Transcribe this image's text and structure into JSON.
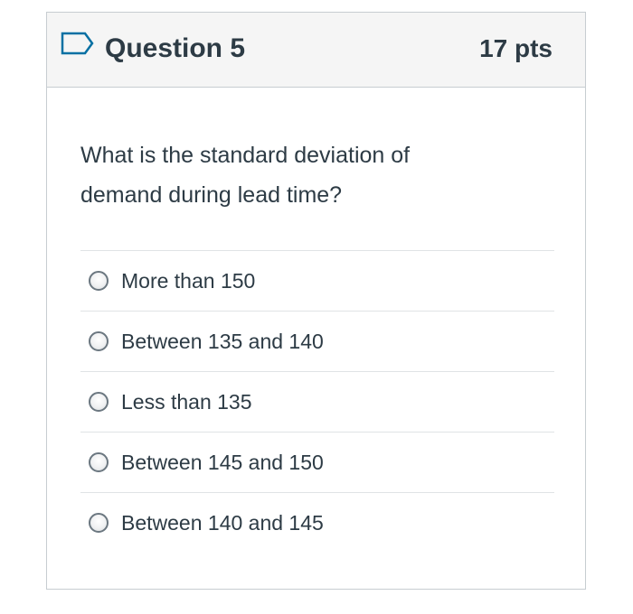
{
  "question": {
    "title": "Question 5",
    "points": "17 pts",
    "text": "What is the standard deviation of demand during lead time?",
    "flag_icon": "bookmark-flag-icon",
    "accent_color": "#0770a3"
  },
  "answers": [
    {
      "label": "More than 150"
    },
    {
      "label": "Between 135 and 140"
    },
    {
      "label": "Less than 135"
    },
    {
      "label": "Between 145 and 150"
    },
    {
      "label": "Between 140 and 145"
    }
  ]
}
